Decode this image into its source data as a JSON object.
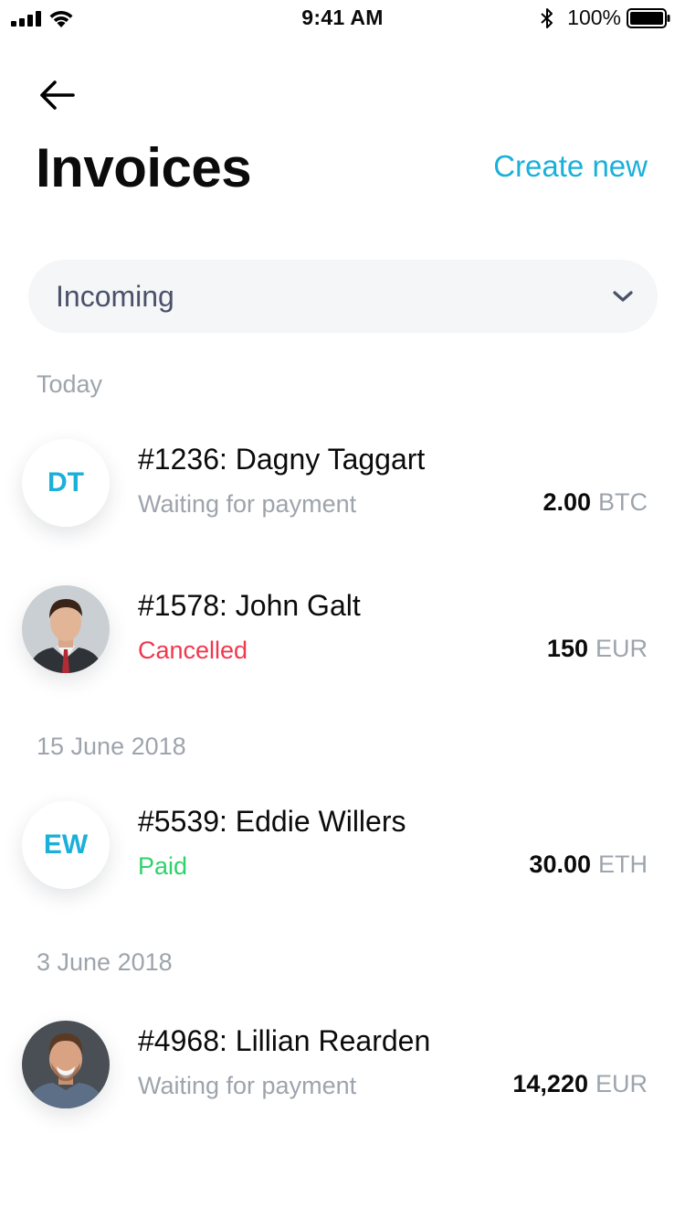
{
  "status_bar": {
    "time": "9:41 AM",
    "battery_percent": "100%",
    "icons": [
      "signal-icon",
      "wifi-icon",
      "bluetooth-icon",
      "battery-icon"
    ]
  },
  "header": {
    "back_icon": "back-arrow-icon",
    "title": "Invoices",
    "create_label": "Create new"
  },
  "filter": {
    "selected": "Incoming",
    "icon": "chevron-down-icon"
  },
  "colors": {
    "accent": "#1ab0d9",
    "muted": "#9ea4ac",
    "cancelled": "#f0384d",
    "paid": "#2ed26a",
    "select_bg": "#f4f6f7",
    "select_text": "#4a5169"
  },
  "sections": [
    {
      "label": "Today",
      "invoices": [
        {
          "title": "#1236: Dagny Taggart",
          "status": "Waiting for payment",
          "status_type": "waiting",
          "amount": "2.00",
          "currency": "BTC",
          "avatar": {
            "type": "initials",
            "initials": "DT"
          }
        },
        {
          "title": "#1578: John Galt",
          "status": "Cancelled",
          "status_type": "cancelled",
          "amount": "150",
          "currency": "EUR",
          "avatar": {
            "type": "photo"
          }
        }
      ]
    },
    {
      "label": "15 June 2018",
      "invoices": [
        {
          "title": "#5539: Eddie Willers",
          "status": "Paid",
          "status_type": "paid",
          "amount": "30.00",
          "currency": "ETH",
          "avatar": {
            "type": "initials",
            "initials": "EW"
          }
        }
      ]
    },
    {
      "label": "3 June 2018",
      "invoices": [
        {
          "title": "#4968: Lillian Rearden",
          "status": "Waiting for payment",
          "status_type": "waiting",
          "amount": "14,220",
          "currency": "EUR",
          "avatar": {
            "type": "photo"
          }
        }
      ]
    }
  ]
}
